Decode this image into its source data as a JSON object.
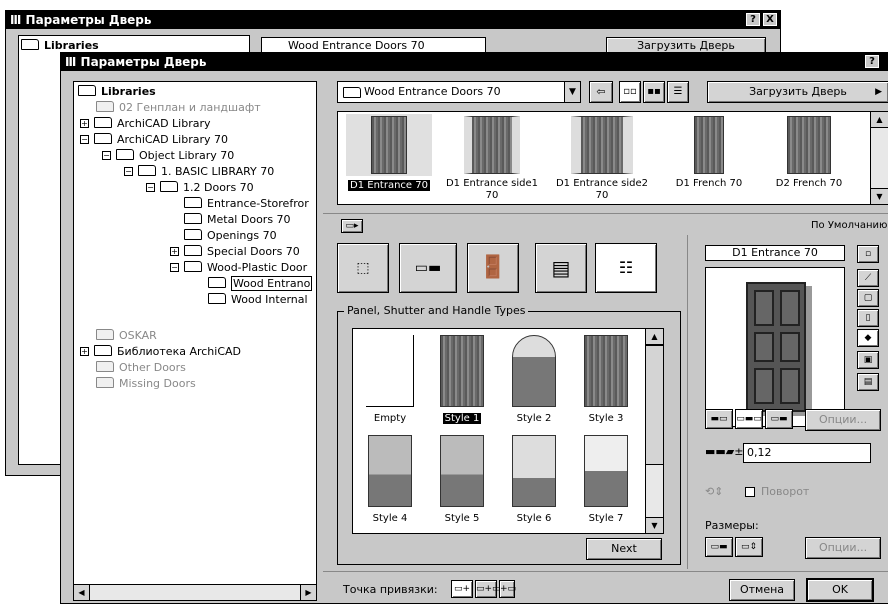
{
  "back_window": {
    "title": "Параметры Дверь",
    "tree_root": "Libraries",
    "dropdown_value": "Wood Entrance Doors 70",
    "load_button": "Загрузить Дверь",
    "help_btn": "?",
    "close_btn": "X"
  },
  "window": {
    "title": "Параметры Дверь",
    "help_btn": "?",
    "close_btn": "X"
  },
  "tree": {
    "items": [
      {
        "label": "Libraries"
      },
      {
        "label": "02 Генплан и ландшафт"
      },
      {
        "label": "ArchiCAD Library"
      },
      {
        "label": "ArchiCAD Library 70"
      },
      {
        "label": "Object Library 70"
      },
      {
        "label": "1. BASIC LIBRARY 70"
      },
      {
        "label": "1.2 Doors 70"
      },
      {
        "label": "Entrance-Storefror"
      },
      {
        "label": "Metal Doors 70"
      },
      {
        "label": "Openings 70"
      },
      {
        "label": "Special Doors 70"
      },
      {
        "label": "Wood-Plastic Door"
      },
      {
        "label": "Wood Entrano"
      },
      {
        "label": "Wood Internal"
      },
      {
        "label": "OSKAR"
      },
      {
        "label": "Библиотека ArchiCAD"
      },
      {
        "label": "Other Doors"
      },
      {
        "label": "Missing Doors"
      }
    ]
  },
  "library_dropdown": {
    "value": "Wood Entrance Doors 70",
    "arrow": "▼"
  },
  "load_button": {
    "label": "Загрузить Дверь",
    "arrow": "▶"
  },
  "thumbnails": [
    {
      "label": "D1 Entrance 70"
    },
    {
      "label": "D1 Entrance side1 70"
    },
    {
      "label": "D1 Entrance side2 70"
    },
    {
      "label": "D1 French 70"
    },
    {
      "label": "D2 French 70"
    }
  ],
  "default_label": "По Умолчанию",
  "groupbox_title": "Panel, Shutter and Handle Types",
  "styles": [
    {
      "label": "Empty"
    },
    {
      "label": "Style 1"
    },
    {
      "label": "Style 2"
    },
    {
      "label": "Style 3"
    },
    {
      "label": "Style 4"
    },
    {
      "label": "Style 5"
    },
    {
      "label": "Style 6"
    },
    {
      "label": "Style 7"
    }
  ],
  "next_button": "Next",
  "preview_title": "D1 Entrance 70",
  "options_button": "Опции...",
  "thickness_value": "0,12",
  "rotate_label": "Поворот",
  "sizes_label": "Размеры:",
  "options_button_2": "Опции...",
  "anchor_label": "Точка привязки:",
  "cancel_button": "Отмена",
  "ok_button": "OK",
  "icons": [
    "folder-icon",
    "up-folder-icon",
    "view-large-icon",
    "view-small-icon",
    "view-list-icon",
    "door-icon",
    "gear-icon"
  ]
}
